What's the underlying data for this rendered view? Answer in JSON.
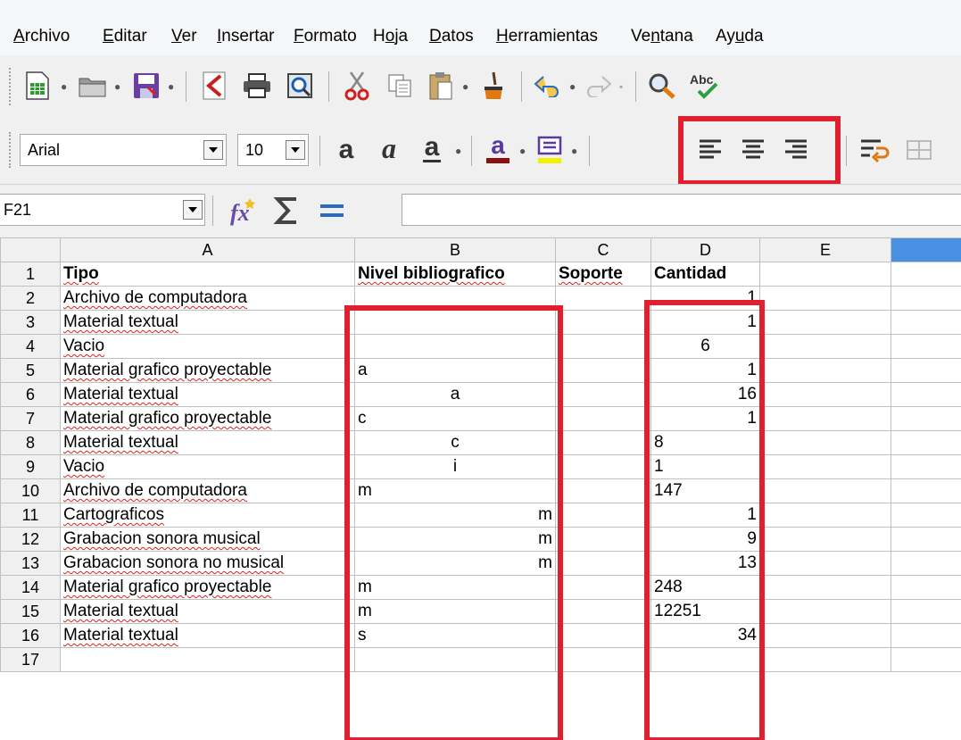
{
  "menu": [
    {
      "label": "Archivo",
      "key": "A",
      "rest": "rchivo"
    },
    {
      "label": "Editar",
      "key": "E",
      "rest": "ditar"
    },
    {
      "label": "Ver",
      "key": "V",
      "rest": "er"
    },
    {
      "label": "Insertar",
      "key": "I",
      "rest": "nsertar"
    },
    {
      "label": "Formato",
      "key": "F",
      "rest": "ormato"
    },
    {
      "label": "Hoja",
      "pre": "H",
      "key": "o",
      "rest": "ja"
    },
    {
      "label": "Datos",
      "key": "D",
      "rest": "atos"
    },
    {
      "label": "Herramientas",
      "key": "H",
      "rest": "erramientas"
    },
    {
      "label": "Ventana",
      "pre": "Ve",
      "key": "n",
      "rest": "tana"
    },
    {
      "label": "Ayuda",
      "pre": "Ay",
      "key": "u",
      "rest": "da"
    }
  ],
  "formatting": {
    "font_name": "Arial",
    "font_size": "10"
  },
  "formula_bar": {
    "name_box": "F21",
    "input_value": ""
  },
  "sheet": {
    "columns": [
      "A",
      "B",
      "C",
      "D",
      "E"
    ],
    "rows": [
      {
        "n": "1",
        "a": "Tipo",
        "b": "Nivel bibliografico",
        "c": "Soporte",
        "d": "Cantidad"
      },
      {
        "n": "2",
        "a": "Archivo de computadora",
        "b": "",
        "c": "",
        "d": "1"
      },
      {
        "n": "3",
        "a": "Material textual",
        "b": "",
        "c": "",
        "d": "1"
      },
      {
        "n": "4",
        "a": "Vacio",
        "b": "",
        "c": "",
        "d": "6"
      },
      {
        "n": "5",
        "a": "Material grafico proyectable",
        "b": "a",
        "c": "",
        "d": "1"
      },
      {
        "n": "6",
        "a": "Material textual",
        "b": "a",
        "c": "",
        "d": "16"
      },
      {
        "n": "7",
        "a": "Material grafico proyectable",
        "b": "c",
        "c": "",
        "d": "1"
      },
      {
        "n": "8",
        "a": "Material textual",
        "b": "c",
        "c": "",
        "d": "8"
      },
      {
        "n": "9",
        "a": "Vacio",
        "b": "i",
        "c": "",
        "d": "1"
      },
      {
        "n": "10",
        "a": "Archivo de computadora",
        "b": "m",
        "c": "",
        "d": "147"
      },
      {
        "n": "11",
        "a": "Cartograficos",
        "b": "m",
        "c": "",
        "d": "1"
      },
      {
        "n": "12",
        "a": "Grabacion sonora musical",
        "b": "m",
        "c": "",
        "d": "9"
      },
      {
        "n": "13",
        "a": "Grabacion sonora no musical",
        "b": "m",
        "c": "",
        "d": "13"
      },
      {
        "n": "14",
        "a": "Material grafico proyectable",
        "b": "m",
        "c": "",
        "d": "248"
      },
      {
        "n": "15",
        "a": "Material textual",
        "b": "m",
        "c": "",
        "d": "12251"
      },
      {
        "n": "16",
        "a": "Material textual",
        "b": "s",
        "c": "",
        "d": "34"
      },
      {
        "n": "17",
        "a": "",
        "b": "",
        "c": "",
        "d": ""
      }
    ]
  },
  "colors": {
    "highlight_red": "#e0202f",
    "selected_column": "#4a90e2"
  }
}
